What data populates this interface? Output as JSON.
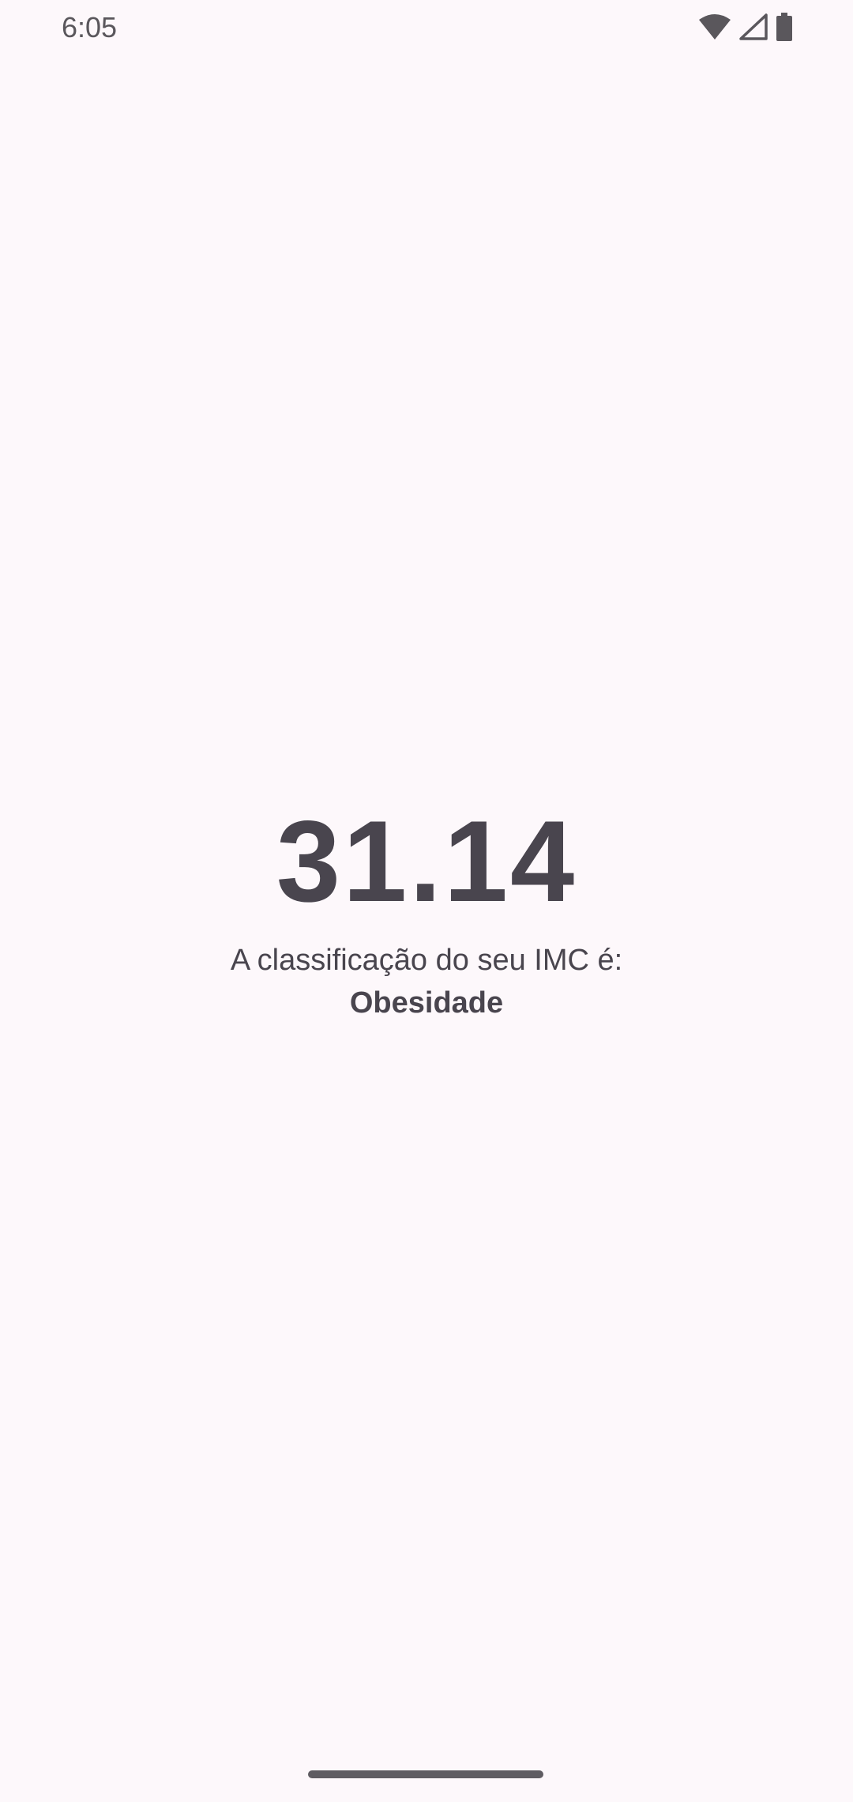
{
  "status_bar": {
    "time": "6:05",
    "icons": [
      "wifi-icon",
      "cellular-signal-icon",
      "battery-icon"
    ]
  },
  "result": {
    "bmi_value": "31.14",
    "classification_label": "A classificação do seu IMC é:",
    "classification_value": "Obesidade"
  },
  "colors": {
    "background": "#fdf8fb",
    "text": "#49454e",
    "status_text": "#5a575c"
  }
}
